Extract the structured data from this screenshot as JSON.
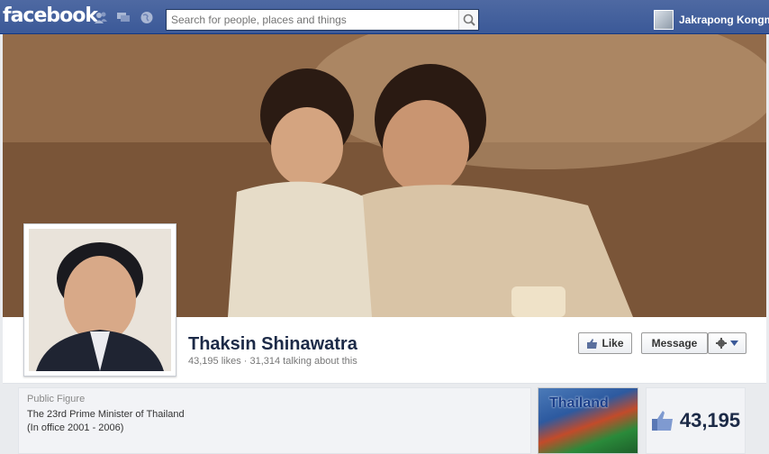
{
  "topbar": {
    "logo": "facebook",
    "search_placeholder": "Search for people, places and things",
    "user_name": "Jakrapong Kongm",
    "icons": [
      "friends-icon",
      "messages-icon",
      "notifications-globe-icon",
      "search-icon"
    ]
  },
  "profile": {
    "name": "Thaksin Shinawatra",
    "stats": "43,195 likes · 31,314 talking about this",
    "like_label": "Like",
    "message_label": "Message",
    "category": "Public Figure",
    "desc_line1": "The 23rd Prime Minister of Thailand",
    "desc_line2": "(In office 2001 - 2006)",
    "photo_tile_text": "Thailand",
    "likes_count": "43,195"
  },
  "colors": {
    "brand": "#3b5998",
    "name": "#1c2a47"
  }
}
